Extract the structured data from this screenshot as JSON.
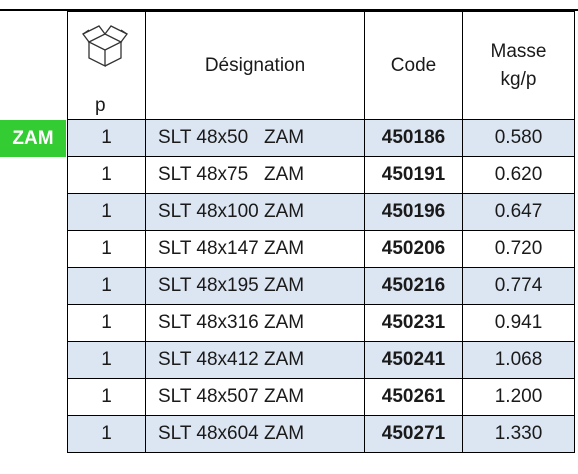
{
  "badge": "ZAM",
  "headers": {
    "pack_unit": "p",
    "designation": "Désignation",
    "code": "Code",
    "masse_line1": "Masse",
    "masse_line2": "kg/p"
  },
  "rows": [
    {
      "qty": "1",
      "designation": "SLT 48x50   ZAM",
      "code": "450186",
      "masse": "0.580"
    },
    {
      "qty": "1",
      "designation": "SLT 48x75   ZAM",
      "code": "450191",
      "masse": "0.620"
    },
    {
      "qty": "1",
      "designation": "SLT 48x100 ZAM",
      "code": "450196",
      "masse": "0.647"
    },
    {
      "qty": "1",
      "designation": "SLT 48x147 ZAM",
      "code": "450206",
      "masse": "0.720"
    },
    {
      "qty": "1",
      "designation": "SLT 48x195 ZAM",
      "code": "450216",
      "masse": "0.774"
    },
    {
      "qty": "1",
      "designation": "SLT 48x316 ZAM",
      "code": "450231",
      "masse": "0.941"
    },
    {
      "qty": "1",
      "designation": "SLT 48x412 ZAM",
      "code": "450241",
      "masse": "1.068"
    },
    {
      "qty": "1",
      "designation": "SLT 48x507 ZAM",
      "code": "450261",
      "masse": "1.200"
    },
    {
      "qty": "1",
      "designation": "SLT 48x604 ZAM",
      "code": "450271",
      "masse": "1.330"
    }
  ],
  "colors": {
    "badge": "#33cc33",
    "row_shade": "#dce6f2"
  }
}
